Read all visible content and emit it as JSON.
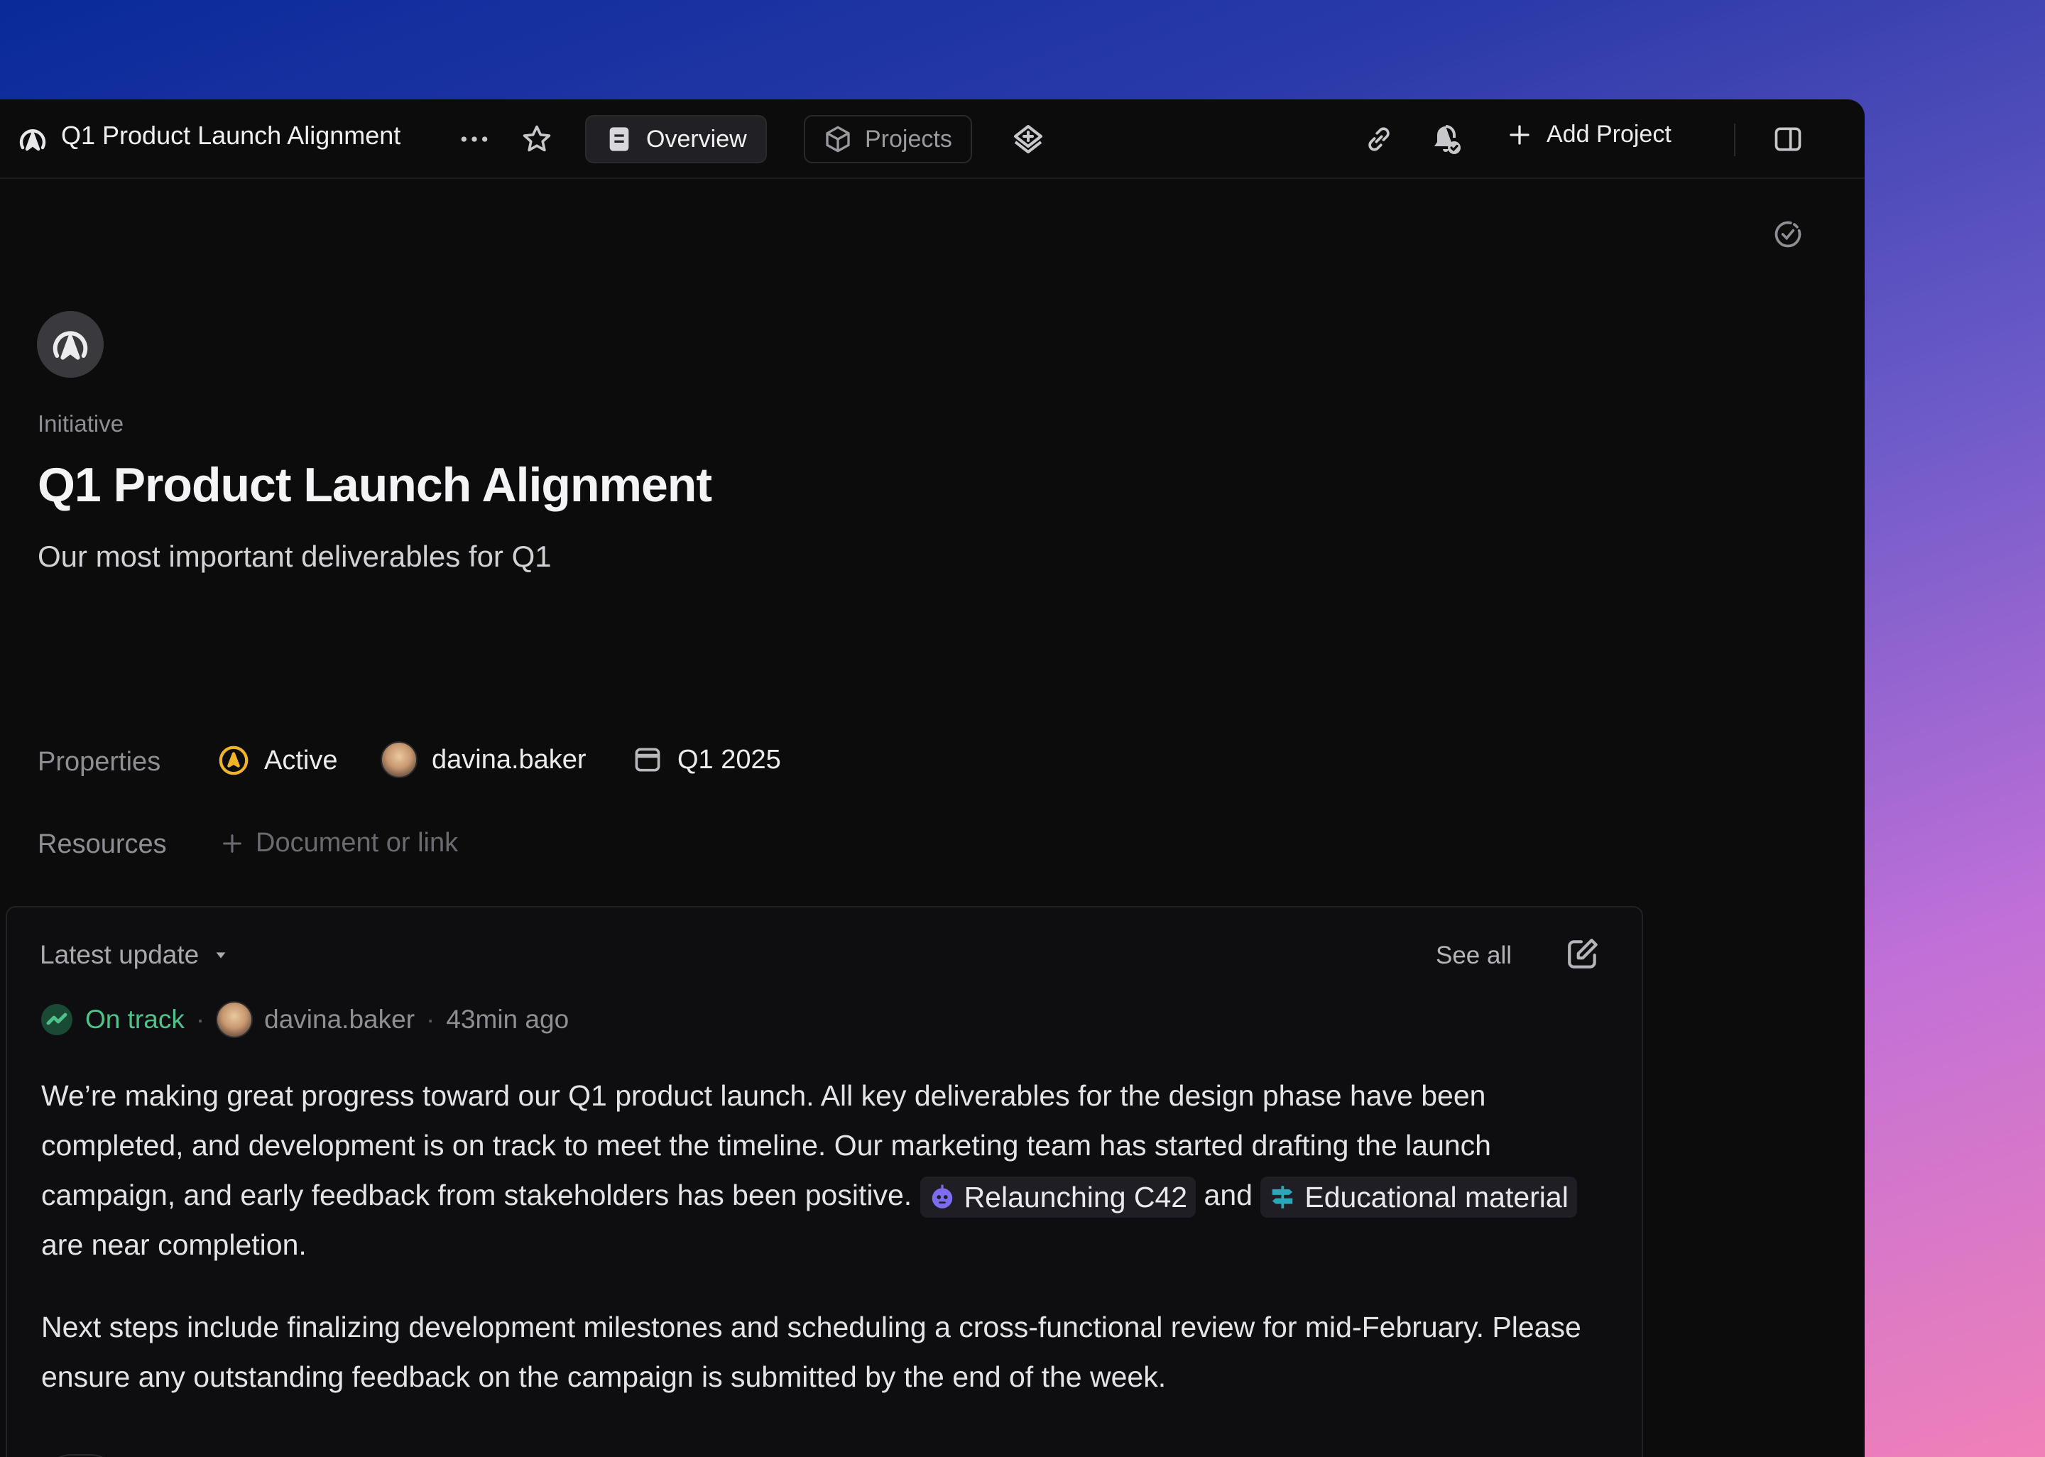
{
  "topbar": {
    "title": "Q1 Product Launch Alignment",
    "tabs": [
      {
        "label": "Overview",
        "active": true,
        "icon": "document-icon"
      },
      {
        "label": "Projects",
        "active": false,
        "icon": "cube-icon"
      }
    ],
    "add_project_label": "Add Project"
  },
  "initiative": {
    "kind_label": "Initiative",
    "title": "Q1 Product Launch Alignment",
    "description": "Our most important deliverables for Q1"
  },
  "properties": {
    "label": "Properties",
    "status": "Active",
    "owner": "davina.baker",
    "target": "Q1 2025"
  },
  "resources": {
    "label": "Resources",
    "add_placeholder": "Document or link"
  },
  "update": {
    "header": "Latest update",
    "see_all": "See all",
    "status": "On track",
    "author": "davina.baker",
    "time": "43min ago",
    "p1_part1": "We’re making great progress toward our Q1 product launch. All key deliverables for the design phase have been completed, and development is on track to meet the timeline. Our marketing team has started drafting the launch campaign, and early feedback from stakeholders has been positive.",
    "chip1": "Relaunching C42",
    "p1_and": "and",
    "chip2": "Educational material",
    "p1_part2": "are near completion.",
    "p2": "Next steps include finalizing development milestones and scheduling a cross-functional review for mid-February. Please ensure any outstanding feedback on the campaign is submitted by the end of the week."
  },
  "colors": {
    "status_active": "#f0b429",
    "status_on_track": "#4cc38a",
    "chip_robot": "#7c6cf0",
    "chip_sign": "#2aa8b8"
  }
}
